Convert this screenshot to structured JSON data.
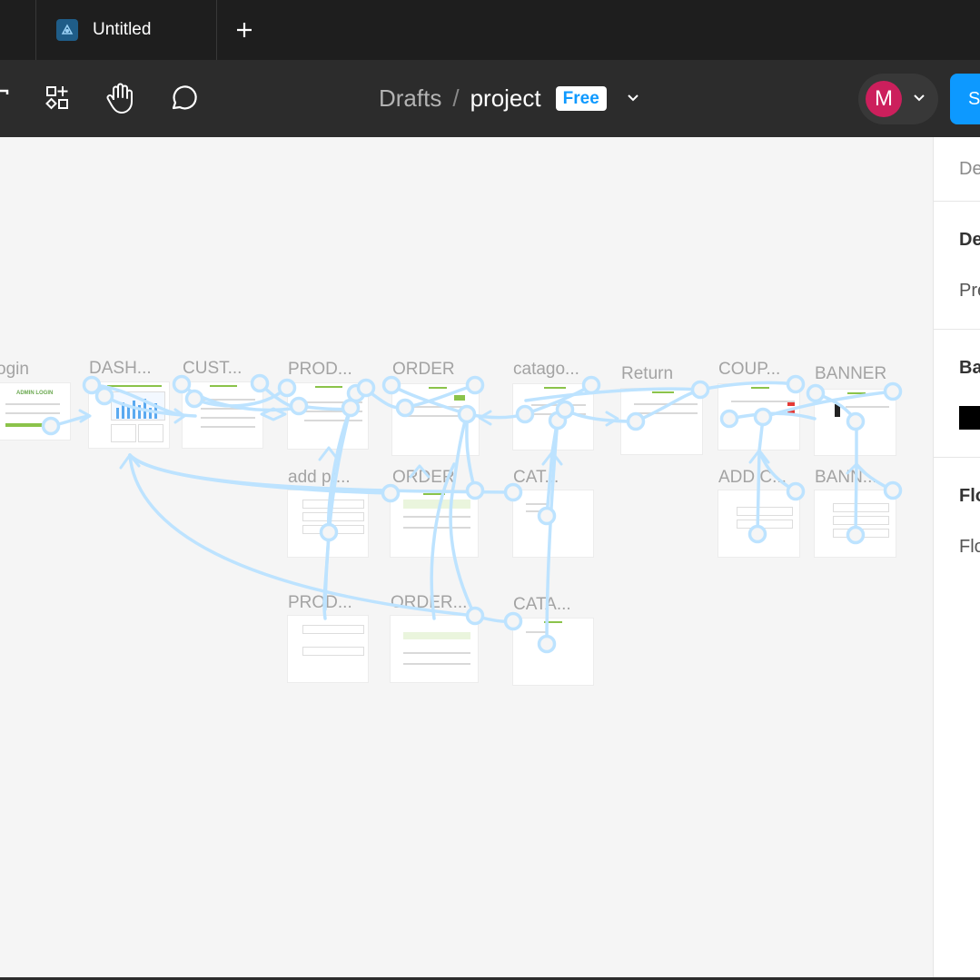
{
  "tabbar": {
    "tab_title": "Untitled",
    "new_tab_label": "+"
  },
  "toolbar": {
    "breadcrumb_drafts": "Drafts",
    "breadcrumb_separator": "/",
    "breadcrumb_project": "project",
    "plan_badge": "Free",
    "avatar_initial": "M",
    "share_label": "S"
  },
  "canvas": {
    "frames": [
      {
        "label": "ogin",
        "title": "ADMIN LOGIN"
      },
      {
        "label": "DASH..."
      },
      {
        "label": "CUST..."
      },
      {
        "label": "PROD..."
      },
      {
        "label": "ORDER"
      },
      {
        "label": "catago..."
      },
      {
        "label": "Return"
      },
      {
        "label": "COUP..."
      },
      {
        "label": "BANNER"
      },
      {
        "label": "add pr..."
      },
      {
        "label": "ORDER"
      },
      {
        "label": "CAT..."
      },
      {
        "label": "ADD C..."
      },
      {
        "label": "BANN..."
      },
      {
        "label": "PROD..."
      },
      {
        "label": "ORDER..."
      },
      {
        "label": "CATA..."
      }
    ],
    "connector_color": "#bde3ff"
  },
  "panel": {
    "row1": "De",
    "row2": "De",
    "row3": "Pre",
    "row4": "Ba",
    "row5": "Flo",
    "row6": "Flo"
  },
  "colors": {
    "accent": "#0d99ff",
    "avatar": "#cc1f5c",
    "frame_green": "#8bc34a"
  }
}
